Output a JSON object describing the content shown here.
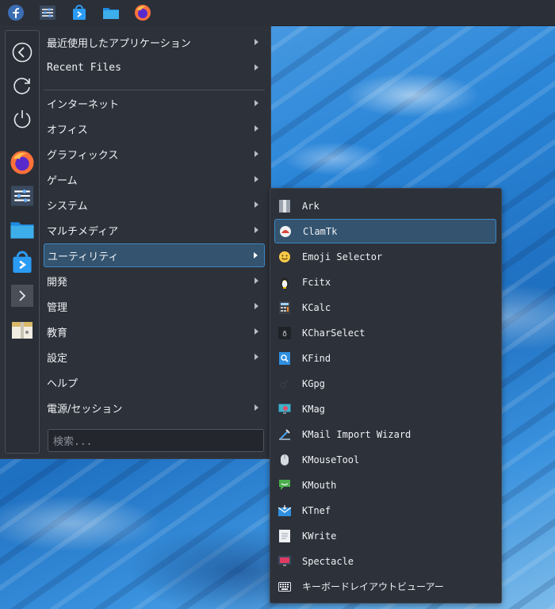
{
  "top_panel": {
    "icons": [
      "fedora-logo-icon",
      "system-settings-icon",
      "discover-store-icon",
      "file-manager-icon",
      "firefox-icon"
    ]
  },
  "sidebar": {
    "icons": [
      "back-icon",
      "restart-icon",
      "power-icon",
      "firefox-icon",
      "system-settings-icon",
      "file-manager-icon",
      "discover-store-icon",
      "terminal-icon",
      "archive-icon"
    ]
  },
  "menu": {
    "items": [
      {
        "label": "最近使用したアプリケーション",
        "has_submenu": true
      },
      {
        "label": "Recent Files",
        "has_submenu": true
      },
      {
        "label": "インターネット",
        "has_submenu": true
      },
      {
        "label": "オフィス",
        "has_submenu": true
      },
      {
        "label": "グラフィックス",
        "has_submenu": true
      },
      {
        "label": "ゲーム",
        "has_submenu": true
      },
      {
        "label": "システム",
        "has_submenu": true
      },
      {
        "label": "マルチメディア",
        "has_submenu": true
      },
      {
        "label": "ユーティリティ",
        "has_submenu": true
      },
      {
        "label": "開発",
        "has_submenu": true
      },
      {
        "label": "管理",
        "has_submenu": true
      },
      {
        "label": "教育",
        "has_submenu": true
      },
      {
        "label": "設定",
        "has_submenu": true
      },
      {
        "label": "ヘルプ",
        "has_submenu": false
      },
      {
        "label": "電源/セッション",
        "has_submenu": true
      }
    ],
    "active_item": "ユーティリティ"
  },
  "search": {
    "placeholder": "検索..."
  },
  "submenu": {
    "items": [
      {
        "label": "Ark",
        "icon": "ark-icon"
      },
      {
        "label": "ClamTk",
        "icon": "clamtk-icon"
      },
      {
        "label": "Emoji Selector",
        "icon": "emoji-icon"
      },
      {
        "label": "Fcitx",
        "icon": "fcitx-penguin-icon"
      },
      {
        "label": "KCalc",
        "icon": "kcalc-icon"
      },
      {
        "label": "KCharSelect",
        "icon": "kcharselect-icon"
      },
      {
        "label": "KFind",
        "icon": "kfind-icon"
      },
      {
        "label": "KGpg",
        "icon": "kgpg-icon"
      },
      {
        "label": "KMag",
        "icon": "kmag-icon"
      },
      {
        "label": "KMail Import Wizard",
        "icon": "kmail-import-icon"
      },
      {
        "label": "KMouseTool",
        "icon": "kmousetool-icon"
      },
      {
        "label": "KMouth",
        "icon": "kmouth-icon"
      },
      {
        "label": "KTnef",
        "icon": "ktnef-icon"
      },
      {
        "label": "KWrite",
        "icon": "kwrite-icon"
      },
      {
        "label": "Spectacle",
        "icon": "spectacle-icon"
      },
      {
        "label": "キーボードレイアウトビューアー",
        "icon": "keyboard-icon"
      }
    ],
    "active_item": "ClamTk"
  },
  "colors": {
    "panel_bg": "#2d3139",
    "highlight_bg": "#34536f",
    "highlight_border": "#3c88c4",
    "text": "#eef1f4"
  }
}
